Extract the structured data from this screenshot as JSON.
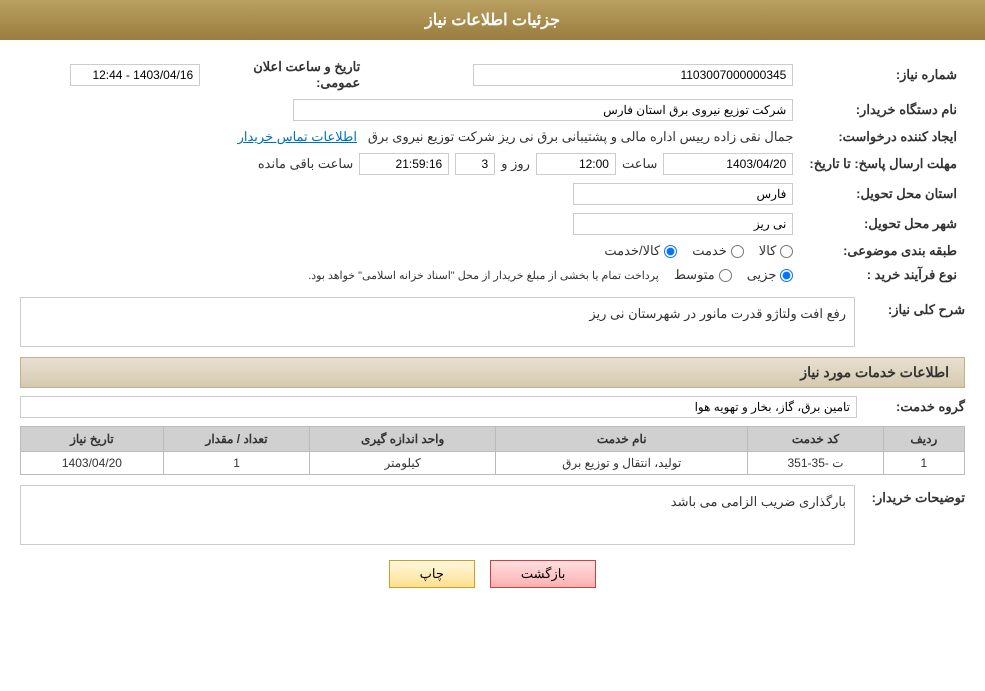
{
  "header": {
    "title": "جزئیات اطلاعات نیاز"
  },
  "fields": {
    "shomareNiaz_label": "شماره نیاز:",
    "shomareNiaz_value": "1103007000000345",
    "namDastgah_label": "نام دستگاه خریدار:",
    "namDastgah_value": "شرکت توزیع نیروی برق استان فارس",
    "tarikh_label": "تاریخ و ساعت اعلان عمومی:",
    "tarikh_value": "1403/04/16 - 12:44",
    "ijadKonande_label": "ایجاد کننده درخواست:",
    "ijadKonande_value": "جمال نقی زاده رییس اداره مالی و پشتیبانی برق نی ریز شرکت توزیع نیروی برق",
    "ettelaatTamas_label": "اطلاعات تماس خریدار",
    "mohlatErsalPasokh_label": "مهلت ارسال پاسخ: تا تاریخ:",
    "date_value": "1403/04/20",
    "saat_label": "ساعت",
    "saat_value": "12:00",
    "rooz_label": "روز و",
    "rooz_value": "3",
    "baghimande_label": "ساعت باقی مانده",
    "baghimande_value": "21:59:16",
    "ostan_label": "استان محل تحویل:",
    "ostan_value": "فارس",
    "shahr_label": "شهر محل تحویل:",
    "shahr_value": "نی ریز",
    "tabaqebandiLabel": "طبقه بندی موضوعی:",
    "tabaqe_kala": "کالا",
    "tabaqe_khadamat": "خدمت",
    "tabaqe_kala_khadamat": "کالا/خدمت",
    "noeFarayand_label": "نوع فرآیند خرید :",
    "noeFarayand_jezvi": "جزیی",
    "noeFarayand_motevaset": "متوسط",
    "noeFarayand_desc": "پرداخت تمام یا بخشی از مبلغ خریدار از محل \"اسناد خزانه اسلامی\" خواهد بود.",
    "sharh_label": "شرح کلی نیاز:",
    "sharh_value": "رفع افت ولتاژو قدرت مانور در شهرستان نی ریز",
    "khadamat_section": "اطلاعات خدمات مورد نیاز",
    "groheKhadamat_label": "گروه خدمت:",
    "groheKhadamat_value": "تامین برق، گاز، بخار و تهویه هوا"
  },
  "table": {
    "headers": [
      "ردیف",
      "کد خدمت",
      "نام خدمت",
      "واحد اندازه گیری",
      "تعداد / مقدار",
      "تاریخ نیاز"
    ],
    "rows": [
      {
        "radif": "1",
        "kod": "ت -35-351",
        "nam": "تولید، انتقال و توزیع برق",
        "vahed": "کیلومتر",
        "tedad": "1",
        "tarikh": "1403/04/20"
      }
    ]
  },
  "tozihat": {
    "label": "توضیحات خریدار:",
    "value": "بارگذاری ضریب الزامی می باشد"
  },
  "buttons": {
    "print": "چاپ",
    "back": "بازگشت"
  }
}
